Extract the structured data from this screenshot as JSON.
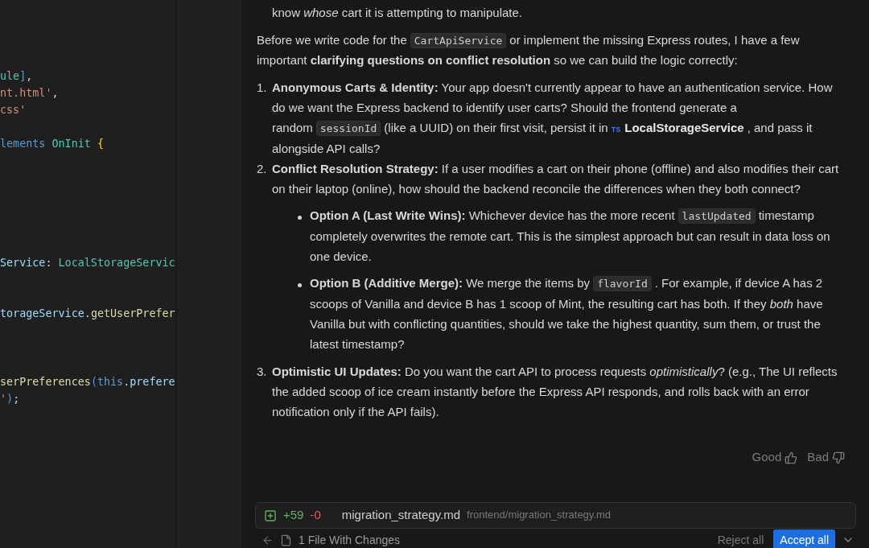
{
  "editor": {
    "blocks": [
      {
        "lines": [
          {
            "tokens": [
              {
                "kind": "type",
                "text": "ule"
              },
              {
                "kind": "bracket",
                "text": "]"
              },
              {
                "kind": "plain",
                "text": ","
              }
            ]
          },
          {
            "tokens": [
              {
                "kind": "string",
                "text": "nt.html'"
              },
              {
                "kind": "plain",
                "text": ","
              }
            ]
          },
          {
            "tokens": [
              {
                "kind": "string",
                "text": "css'"
              }
            ]
          }
        ]
      },
      {
        "lines": [
          {
            "tokens": [
              {
                "kind": "keyword",
                "text": "lements"
              },
              {
                "kind": "type",
                "text": " OnInit"
              },
              {
                "kind": "brace",
                "text": " {"
              }
            ]
          }
        ]
      },
      {
        "lines": [
          {
            "tokens": [
              {
                "kind": "variable",
                "text": "Service"
              },
              {
                "kind": "plain",
                "text": ": "
              },
              {
                "kind": "type",
                "text": "LocalStorageServic"
              }
            ]
          }
        ]
      },
      {
        "lines": [
          {
            "tokens": [
              {
                "kind": "variable",
                "text": "torageService"
              },
              {
                "kind": "plain",
                "text": "."
              },
              {
                "kind": "method",
                "text": "getUserPrefer"
              }
            ]
          }
        ]
      },
      {
        "lines": [
          {
            "tokens": [
              {
                "kind": "method",
                "text": "serPreferences"
              },
              {
                "kind": "bracket",
                "text": "("
              },
              {
                "kind": "keyword",
                "text": "this"
              },
              {
                "kind": "plain",
                "text": "."
              },
              {
                "kind": "variable",
                "text": "prefere"
              }
            ]
          },
          {
            "tokens": [
              {
                "kind": "string",
                "text": "'"
              },
              {
                "kind": "bracket",
                "text": ")"
              },
              {
                "kind": "plain",
                "text": ";"
              }
            ]
          }
        ]
      }
    ]
  },
  "chat": {
    "continuation": [
      {
        "kind": "text",
        "text": "know *whose* cart it is attempting to manipulate."
      }
    ],
    "paragraph": [
      {
        "kind": "text",
        "text": "Before we write code for the"
      },
      {
        "kind": "code",
        "text": "CartApiService"
      },
      {
        "kind": "text",
        "text": "or implement the missing Express routes, I have a few important **clarifying questions on conflict resolution** so we can build the logic correctly:"
      }
    ],
    "questions": [
      {
        "number": "1.",
        "parts": [
          {
            "kind": "text",
            "text": "**Anonymous Carts & Identity:** Your app doesn't currently appear to have an authentication service. How do we want the Express backend to identify user carts? Should the frontend generate a random"
          },
          {
            "kind": "code",
            "text": "sessionId"
          },
          {
            "kind": "text",
            "text": "(like a UUID) on their first visit, persist it in"
          },
          {
            "kind": "file",
            "badge": "TS",
            "text": "LocalStorageService"
          },
          {
            "kind": "text",
            "text": ", and pass it alongside API calls?"
          }
        ]
      },
      {
        "number": "2.",
        "parts": [
          {
            "kind": "text",
            "text": "**Conflict Resolution Strategy:** If a user modifies a cart on their phone (offline) and also modifies their cart on their laptop (online), how should the backend reconcile the differences when they both connect?"
          }
        ],
        "options": [
          {
            "parts": [
              {
                "kind": "text",
                "text": "**Option A (Last Write Wins):** Whichever device has the more recent"
              },
              {
                "kind": "code",
                "text": "lastUpdated"
              },
              {
                "kind": "text",
                "text": "timestamp completely overwrites the remote cart. This is the simplest approach but can result in data loss on one device."
              }
            ]
          },
          {
            "parts": [
              {
                "kind": "text",
                "text": "**Option B (Additive Merge):** We merge the items by"
              },
              {
                "kind": "code",
                "text": "flavorId"
              },
              {
                "kind": "text",
                "text": ". For example, if device A has 2 scoops of Vanilla and device B has 1 scoop of Mint, the resulting cart has both. If they *both* have Vanilla but with conflicting quantities, should we take the highest quantity, sum them, or trust the latest timestamp?"
              }
            ]
          }
        ]
      },
      {
        "number": "3.",
        "parts": [
          {
            "kind": "text",
            "text": "**Optimistic UI Updates:** Do you want the cart API to process requests *optimistically*? (e.g., The UI reflects the added scoop of ice cream instantly before the Express API responds, and rolls back with an error notification only if the API fails)."
          }
        ]
      }
    ],
    "feedback": {
      "good": "Good",
      "bad": "Bad"
    }
  },
  "changes": {
    "file": {
      "added": "+59",
      "removed": "-0",
      "name": "migration_strategy.md",
      "path": "frontend/migration_strategy.md"
    },
    "summary": "1 File With Changes",
    "reject": "Reject all",
    "accept": "Accept all"
  }
}
